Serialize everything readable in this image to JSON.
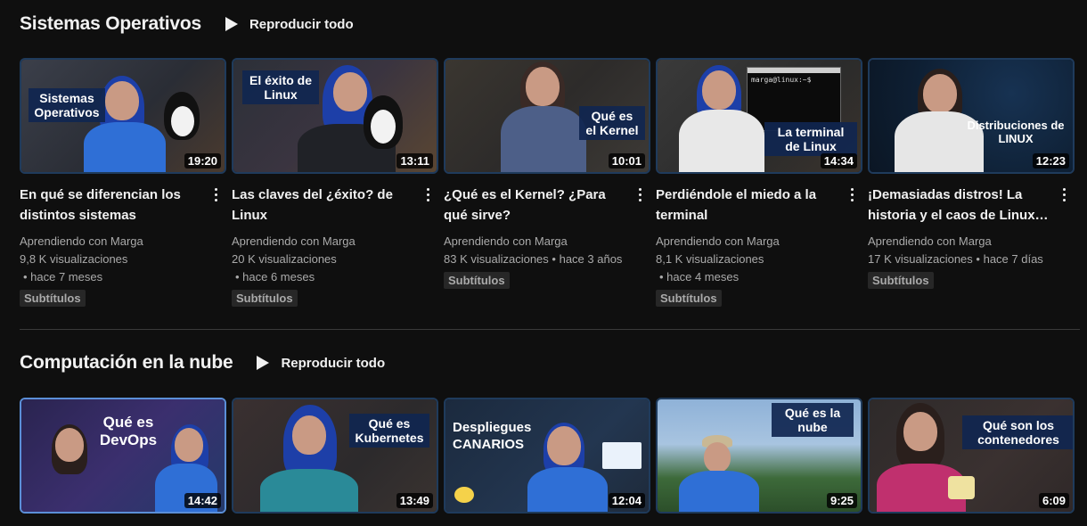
{
  "sections": [
    {
      "title": "Sistemas Operativos",
      "play_all": "Reproducir todo",
      "videos": [
        {
          "thumb_caption": "Sistemas Operativos",
          "duration": "19:20",
          "title": "En qué se diferencian los distintos sistemas operativos",
          "channel": "Aprendiendo con Marga",
          "views": "9,8 K visualizaciones",
          "age": "• hace 7 meses",
          "badge": "Subtítulos"
        },
        {
          "thumb_caption": "El éxito de Linux",
          "duration": "13:11",
          "title": "Las claves del ¿éxito? de Linux",
          "channel": "Aprendiendo con Marga",
          "views": "20 K visualizaciones",
          "age": "• hace 6 meses",
          "badge": "Subtítulos"
        },
        {
          "thumb_caption": "Qué es el Kernel",
          "duration": "10:01",
          "title": "¿Qué es el Kernel? ¿Para qué sirve?",
          "channel": "Aprendiendo con Marga",
          "views": "83 K visualizaciones",
          "age": "• hace 3 años",
          "badge": "Subtítulos"
        },
        {
          "thumb_caption": "La terminal de Linux",
          "duration": "14:34",
          "title": "Perdiéndole el miedo a la terminal",
          "channel": "Aprendiendo con Marga",
          "views": "8,1 K visualizaciones",
          "age": "• hace 4 meses",
          "badge": "Subtítulos",
          "terminal_text": "marga@linux:~$"
        },
        {
          "thumb_caption": "Distribuciones de LINUX",
          "duration": "12:23",
          "title": "¡Demasiadas distros! La historia y el caos de Linux…",
          "channel": "Aprendiendo con Marga",
          "views": "17 K visualizaciones",
          "age": "• hace 7 días",
          "badge": "Subtítulos"
        }
      ]
    },
    {
      "title": "Computación en la nube",
      "play_all": "Reproducir todo",
      "videos": [
        {
          "thumb_caption": "Qué es DevOps",
          "duration": "14:42"
        },
        {
          "thumb_caption": "Qué es Kubernetes",
          "duration": "13:49"
        },
        {
          "thumb_caption": "Despliegues CANARIOS",
          "duration": "12:04"
        },
        {
          "thumb_caption": "Qué es la nube",
          "duration": "9:25"
        },
        {
          "thumb_caption": "Qué son los contenedores",
          "duration": "6:09"
        }
      ]
    }
  ],
  "icons": {
    "play": "play-icon",
    "more": "more-vert-icon"
  },
  "colors": {
    "background": "#0f0f0f",
    "text": "#f1f1f1",
    "secondary_text": "#aaaaaa",
    "badge_bg": "#272727"
  }
}
